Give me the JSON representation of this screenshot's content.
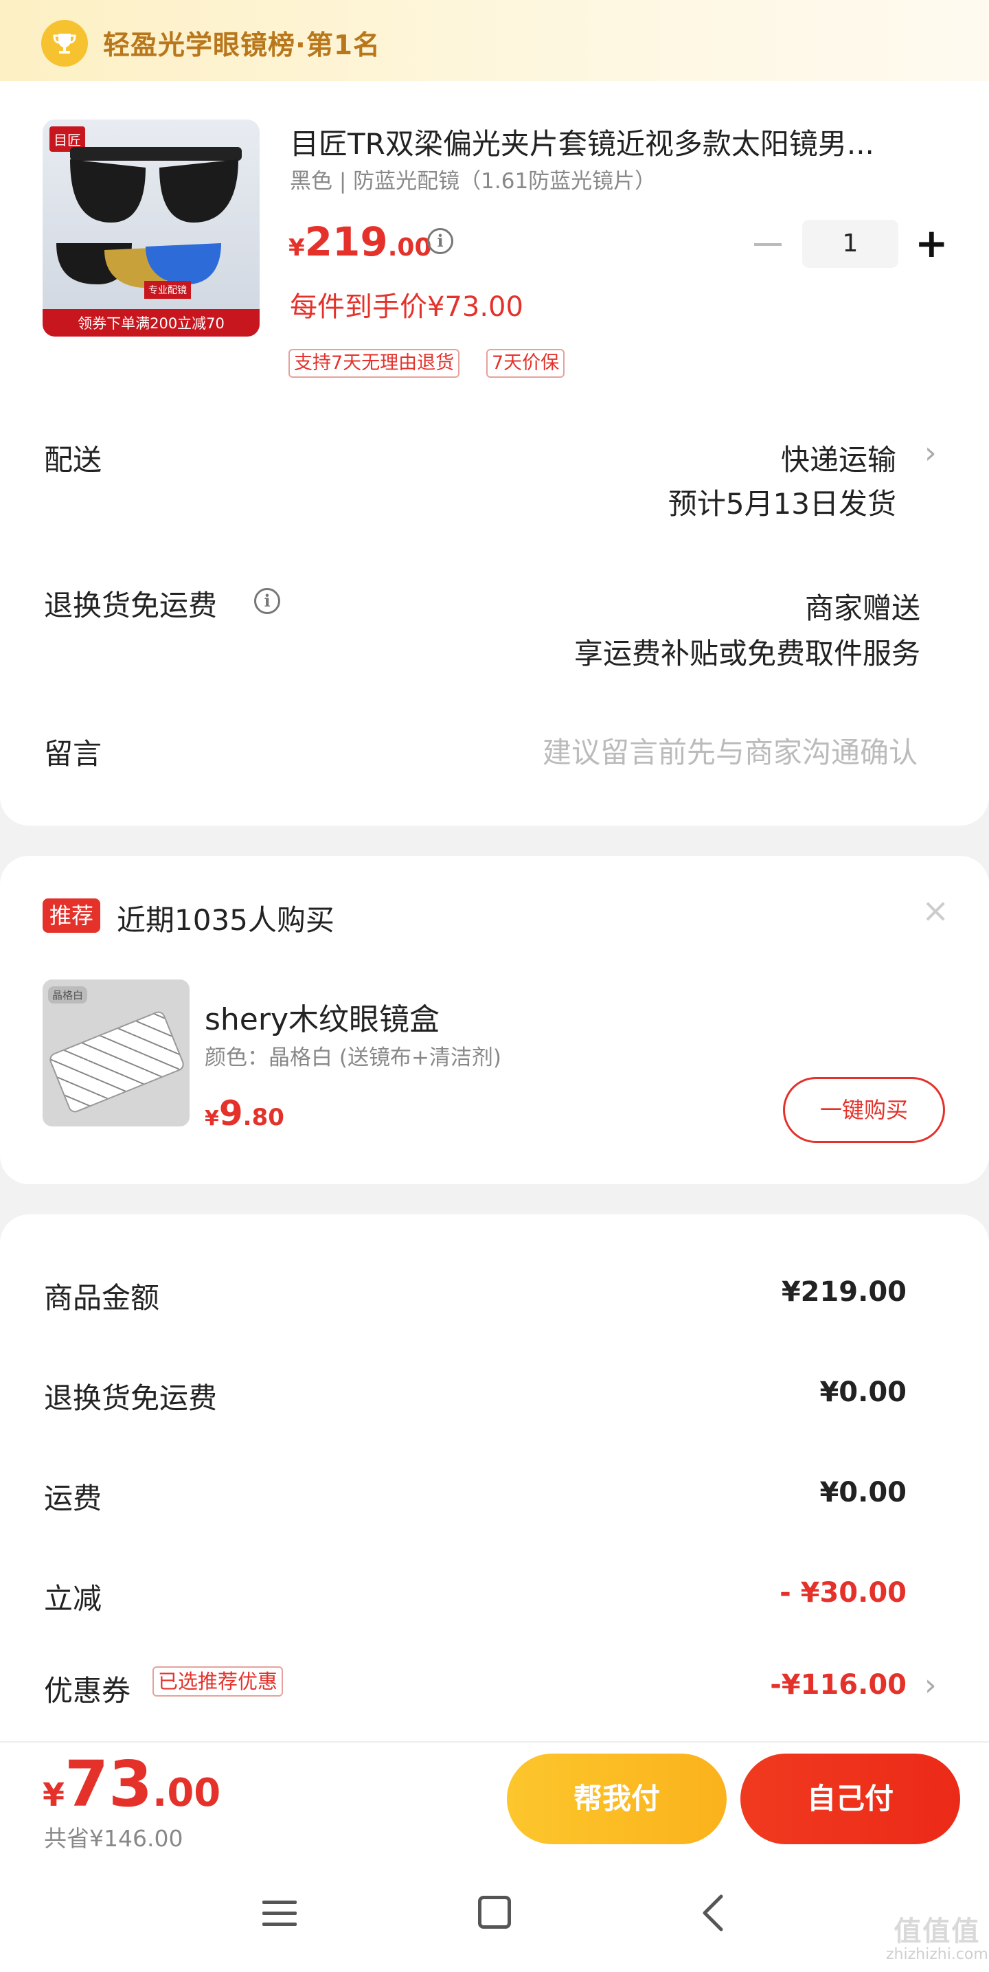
{
  "rank_banner": {
    "text": "轻盈光学眼镜榜·第1名",
    "icon": "trophy-icon"
  },
  "product": {
    "title": "目匠TR双梁偏光夹片套镜近视多款太阳镜男...",
    "spec": "黑色 | 防蓝光配镜（1.61防蓝光镜片）",
    "thumb": {
      "logo": "目匠",
      "tag": "专业配镜",
      "coupon_text": "领券下单满200立减70"
    },
    "price": {
      "currency": "¥",
      "integer": "219",
      "decimal": ".00"
    },
    "per_item_price": "每件到手价¥73.00",
    "service_tags": [
      "支持7天无理由退货",
      "7天价保"
    ],
    "quantity": "1"
  },
  "delivery": {
    "label": "配送",
    "method": "快递运输",
    "eta": "预计5月13日发货"
  },
  "return_shipping": {
    "label": "退换货免运费",
    "value": "商家赠送",
    "desc": "享运费补贴或免费取件服务"
  },
  "message": {
    "label": "留言",
    "placeholder": "建议留言前先与商家沟通确认"
  },
  "recommendation": {
    "badge": "推荐",
    "title": "近期1035人购买",
    "item": {
      "thumb_label": "晶格白",
      "name": "shery木纹眼镜盒",
      "spec": "颜色：晶格白 (送镜布+清洁剂)",
      "price": {
        "currency": "¥",
        "integer": "9",
        "decimal": ".80"
      },
      "buy_label": "一键购买"
    }
  },
  "summary": {
    "rows": [
      {
        "label": "商品金额",
        "value": "¥219.00"
      },
      {
        "label": "退换货免运费",
        "value": "¥0.00"
      },
      {
        "label": "运费",
        "value": "¥0.00"
      },
      {
        "label": "立减",
        "value": "- ¥30.00"
      },
      {
        "label": "优惠券",
        "value": "-¥116.00",
        "tag": "已选推荐优惠"
      }
    ]
  },
  "bottom_bar": {
    "total": {
      "currency": "¥",
      "integer": "73",
      "decimal": ".00"
    },
    "saved": "共省¥146.00",
    "help_pay_label": "帮我付",
    "self_pay_label": "自己付"
  },
  "watermark": {
    "big": "值值值",
    "small": "zhizhizhi.com"
  },
  "colors": {
    "accent_red": "#e4322b",
    "gold": "#f6c22f",
    "rank_text": "#b9771c",
    "help_button": "#fbb21c",
    "pay_button": "#ec2a18"
  }
}
